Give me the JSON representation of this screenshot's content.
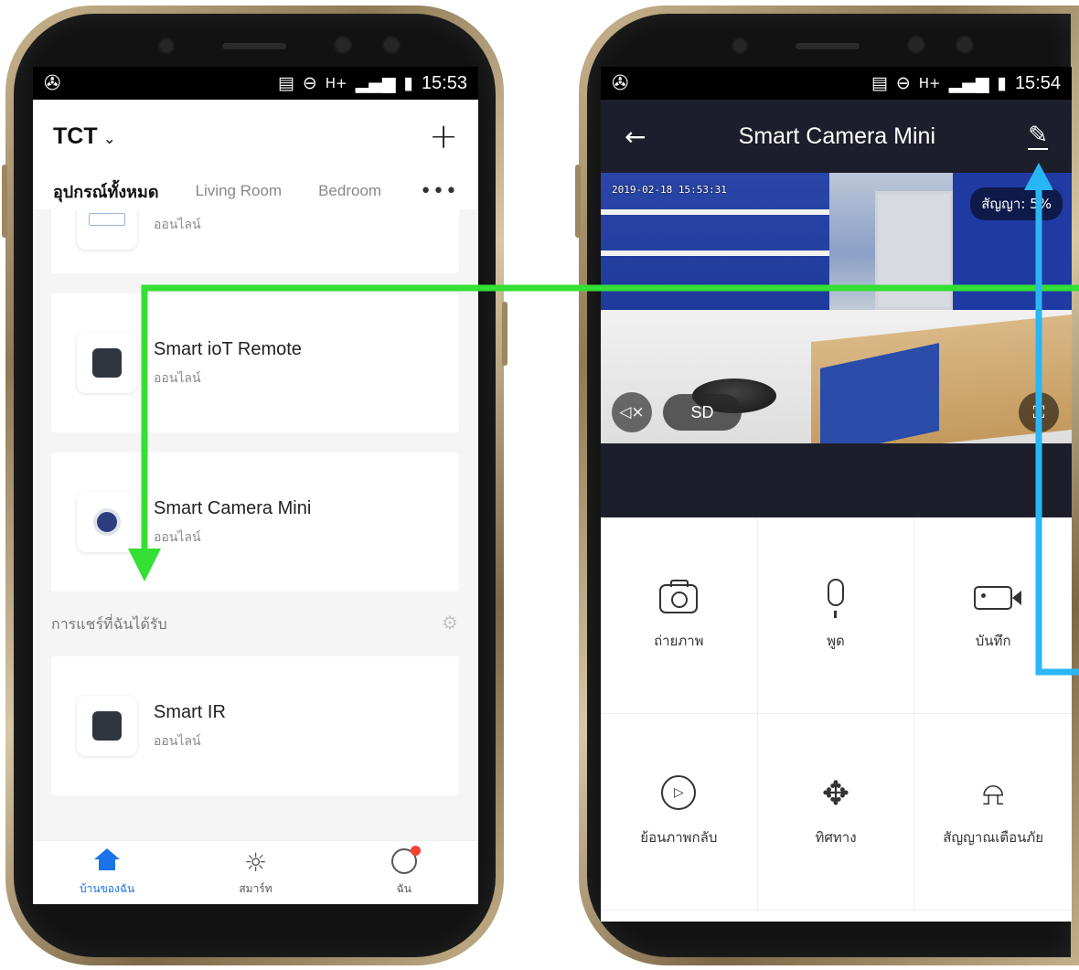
{
  "left_phone": {
    "status_bar": {
      "left_icon": "aperture-icon",
      "right_icons": [
        "cast-icon",
        "do-not-disturb-icon",
        "H+",
        "signal-icon",
        "vibrate-icon",
        "battery-icon"
      ],
      "network": "H+",
      "time": "15:53"
    },
    "header": {
      "home_name": "TCT",
      "dropdown_icon": "chevron-down-icon",
      "add_icon": "plus-icon"
    },
    "tabs": [
      {
        "label": "อุปกรณ์ทั้งหมด",
        "active": true
      },
      {
        "label": "Living Room",
        "active": false
      },
      {
        "label": "Bedroom",
        "active": false
      }
    ],
    "more_icon": "more-icon",
    "devices": [
      {
        "name": "",
        "status": "ออนไลน์",
        "icon": "switch-icon"
      },
      {
        "name": "Smart ioT Remote",
        "status": "ออนไลน์",
        "icon": "remote-icon"
      },
      {
        "name": "Smart Camera Mini",
        "status": "ออนไลน์",
        "icon": "camera-icon"
      }
    ],
    "shared_section": {
      "title": "การแชร์ที่ฉันได้รับ",
      "settings_icon": "gear-icon",
      "devices": [
        {
          "name": "Smart IR",
          "status": "ออนไลน์",
          "icon": "remote-icon"
        }
      ]
    },
    "bottom_nav": [
      {
        "label": "บ้านของฉัน",
        "icon": "home-icon",
        "active": true
      },
      {
        "label": "สมาร์ท",
        "icon": "sun-icon",
        "active": false
      },
      {
        "label": "ฉัน",
        "icon": "profile-icon",
        "active": false
      }
    ]
  },
  "right_phone": {
    "status_bar": {
      "left_icon": "aperture-icon",
      "network": "H+",
      "time": "15:54"
    },
    "header": {
      "back_icon": "back-arrow-icon",
      "title": "Smart Camera Mini",
      "edit_icon": "pencil-icon"
    },
    "video": {
      "timestamp": "2019-02-18 15:53:31",
      "signal_label": "สัญญา: 5",
      "signal_suffix": "%",
      "mute_icon": "mute-icon",
      "quality_label": "SD",
      "fullscreen_icon": "fullscreen-icon"
    },
    "controls": [
      {
        "label": "ถ่ายภาพ",
        "icon": "camera-icon"
      },
      {
        "label": "พูด",
        "icon": "microphone-icon"
      },
      {
        "label": "บันทึก",
        "icon": "video-record-icon"
      },
      {
        "label": "ย้อนภาพกลับ",
        "icon": "playback-icon"
      },
      {
        "label": "ทิศทาง",
        "icon": "direction-icon"
      },
      {
        "label": "สัญญาณเตือนภัย",
        "icon": "alarm-icon"
      }
    ]
  },
  "annotations": {
    "green_arrow_color": "#33e033",
    "blue_arrow_color": "#29b6f6"
  }
}
